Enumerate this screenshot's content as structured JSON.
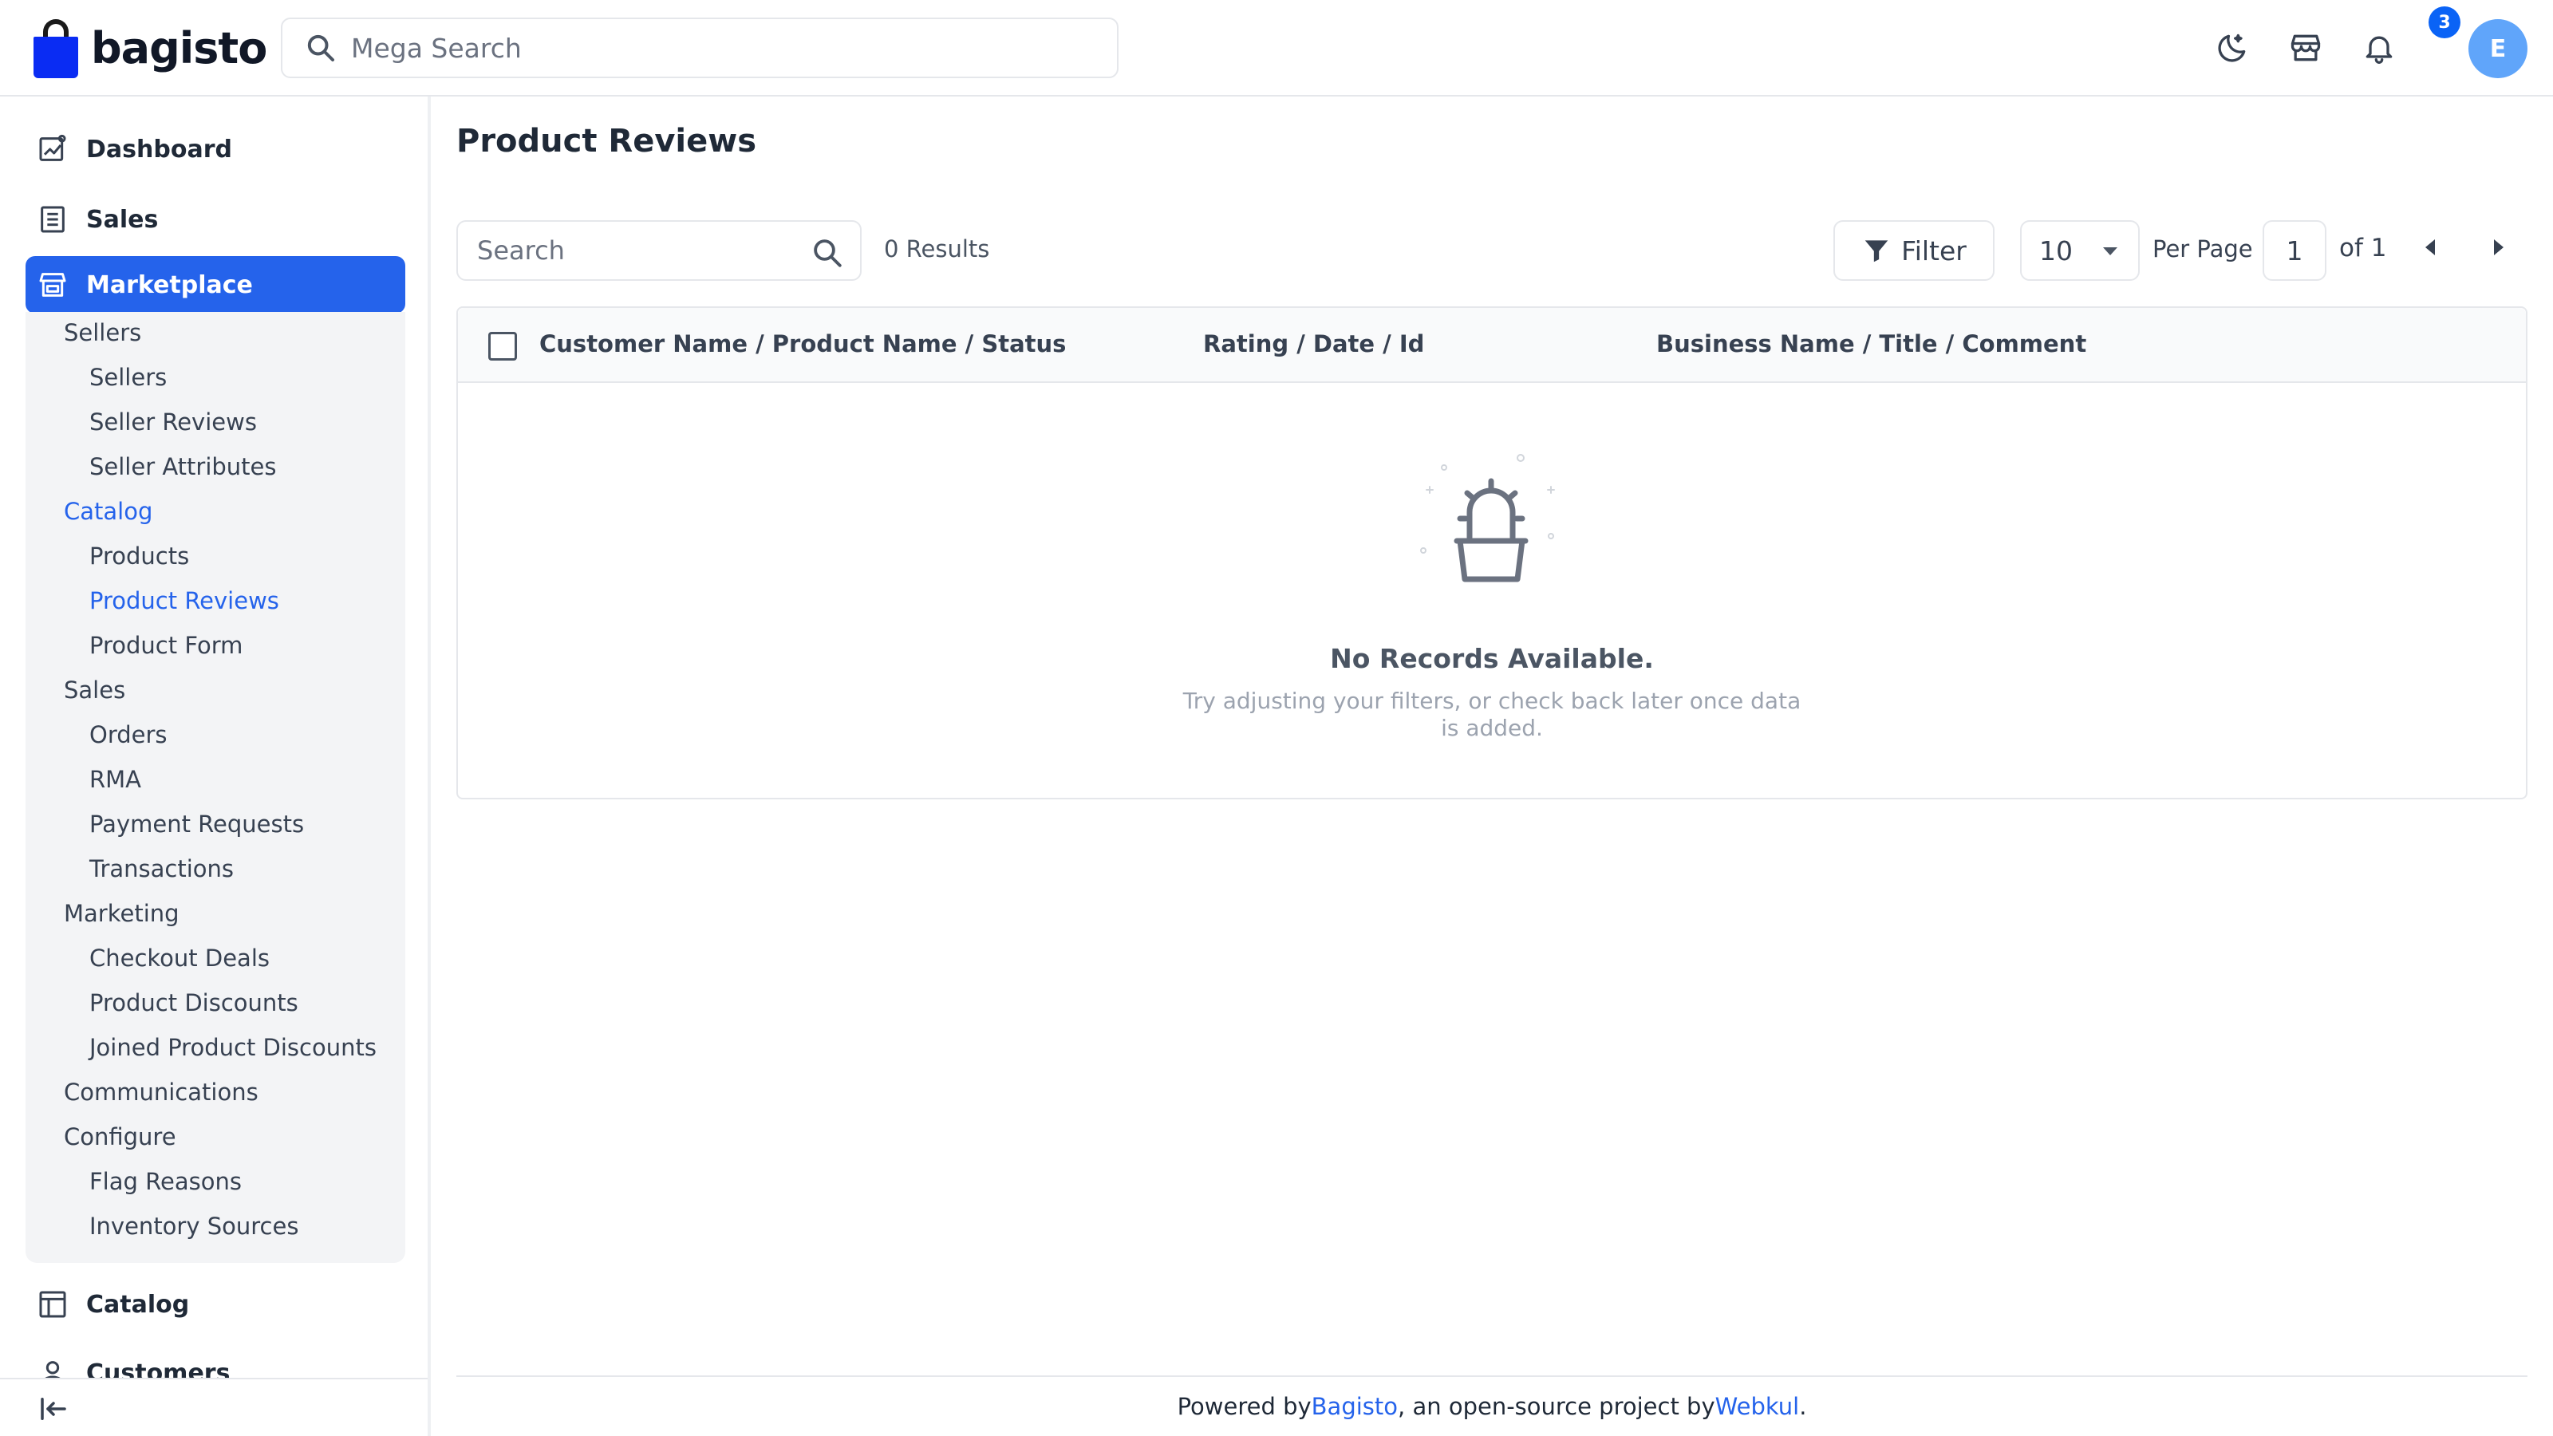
{
  "header": {
    "logo_text": "bagisto",
    "search_placeholder": "Mega Search",
    "notification_count": "3",
    "avatar_initial": "E"
  },
  "sidebar": {
    "top_items": [
      {
        "label": "Dashboard",
        "icon": "dashboard-icon"
      },
      {
        "label": "Sales",
        "icon": "sales-icon"
      },
      {
        "label": "Marketplace",
        "icon": "store-icon",
        "active": true
      }
    ],
    "marketplace_children": [
      {
        "label": "Sellers",
        "level": 1
      },
      {
        "label": "Sellers",
        "level": 2
      },
      {
        "label": "Seller Reviews",
        "level": 2
      },
      {
        "label": "Seller Attributes",
        "level": 2
      },
      {
        "label": "Catalog",
        "level": 1,
        "active": true
      },
      {
        "label": "Products",
        "level": 2
      },
      {
        "label": "Product Reviews",
        "level": 2,
        "active": true
      },
      {
        "label": "Product Form",
        "level": 2
      },
      {
        "label": "Sales",
        "level": 1
      },
      {
        "label": "Orders",
        "level": 2
      },
      {
        "label": "RMA",
        "level": 2
      },
      {
        "label": "Payment Requests",
        "level": 2
      },
      {
        "label": "Transactions",
        "level": 2
      },
      {
        "label": "Marketing",
        "level": 1
      },
      {
        "label": "Checkout Deals",
        "level": 2
      },
      {
        "label": "Product Discounts",
        "level": 2
      },
      {
        "label": "Joined Product Discounts",
        "level": 2
      },
      {
        "label": "Communications",
        "level": 1
      },
      {
        "label": "Configure",
        "level": 1
      },
      {
        "label": "Flag Reasons",
        "level": 2
      },
      {
        "label": "Inventory Sources",
        "level": 2
      }
    ],
    "after_items": [
      {
        "label": "Catalog",
        "icon": "catalog-icon"
      },
      {
        "label": "Customers",
        "icon": "customers-icon"
      }
    ]
  },
  "main": {
    "title": "Product Reviews",
    "search_placeholder": "Search",
    "results": "0 Results",
    "filter_label": "Filter",
    "per_page_value": "10",
    "per_page_label": "Per Page",
    "page_value": "1",
    "of_label": "of 1",
    "columns": [
      "Customer Name / Product Name / Status",
      "Rating / Date / Id",
      "Business Name / Title / Comment"
    ],
    "empty_title": "No Records Available.",
    "empty_desc": "Try adjusting your filters, or check back later once data is added."
  },
  "footer": {
    "prefix": "Powered by ",
    "link1": "Bagisto",
    "middle": ", an open-source project by ",
    "link2": "Webkul",
    "suffix": "."
  },
  "colors": {
    "accent": "#2563eb",
    "logo_blue": "#0a2cf3",
    "badge": "#0a63f6",
    "avatar": "#60a5fa"
  }
}
